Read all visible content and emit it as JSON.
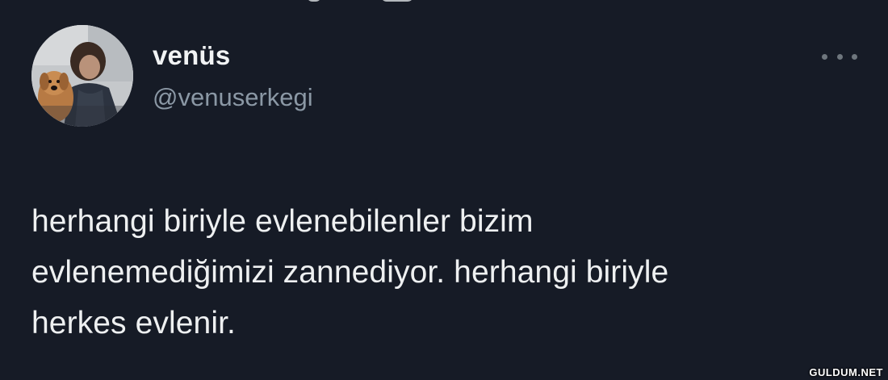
{
  "tweet": {
    "display_name": "venüs",
    "handle": "@venuserkegi",
    "text_lines": [
      "herhangi biriyle evlenebilenler bizim",
      "evlenemediğimizi zannediyor. herhangi biriyle",
      "herkes evlenir."
    ]
  },
  "icons": {
    "more": "more-options-icon",
    "avatar": "profile-photo"
  },
  "colors": {
    "background": "#161b26",
    "name": "#f1f3f4",
    "handle": "#8b98a5",
    "body_text": "#eef0f1"
  },
  "watermark": "GULDUM.NET"
}
